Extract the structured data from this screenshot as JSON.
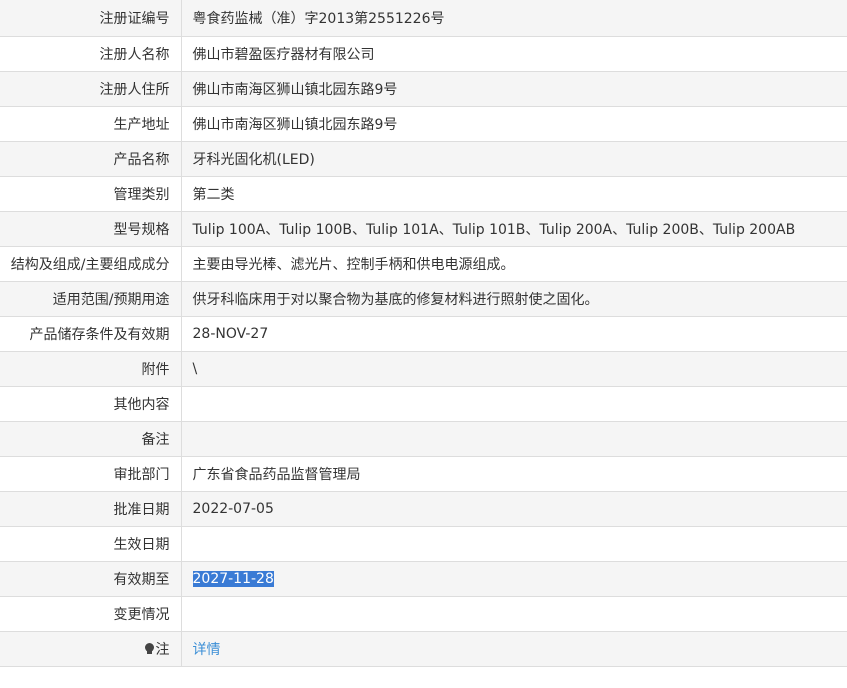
{
  "rows": [
    {
      "label": "注册证编号",
      "value": "粤食药监械（准）字2013第2551226号"
    },
    {
      "label": "注册人名称",
      "value": "佛山市碧盈医疗器材有限公司"
    },
    {
      "label": "注册人住所",
      "value": "佛山市南海区狮山镇北园东路9号"
    },
    {
      "label": "生产地址",
      "value": "佛山市南海区狮山镇北园东路9号"
    },
    {
      "label": "产品名称",
      "value": "牙科光固化机(LED)"
    },
    {
      "label": "管理类别",
      "value": "第二类"
    },
    {
      "label": "型号规格",
      "value": "Tulip 100A、Tulip 100B、Tulip 101A、Tulip 101B、Tulip 200A、Tulip 200B、Tulip 200AB"
    },
    {
      "label": "结构及组成/主要组成成分",
      "value": "主要由导光棒、滤光片、控制手柄和供电电源组成。"
    },
    {
      "label": "适用范围/预期用途",
      "value": "供牙科临床用于对以聚合物为基底的修复材料进行照射使之固化。"
    },
    {
      "label": "产品储存条件及有效期",
      "value": "28-NOV-27"
    },
    {
      "label": "附件",
      "value": "\\"
    },
    {
      "label": "其他内容",
      "value": ""
    },
    {
      "label": "备注",
      "value": ""
    },
    {
      "label": "审批部门",
      "value": "广东省食品药品监督管理局"
    },
    {
      "label": "批准日期",
      "value": "2022-07-05"
    },
    {
      "label": "生效日期",
      "value": ""
    },
    {
      "label": "有效期至",
      "value": "2027-11-28"
    },
    {
      "label": "变更情况",
      "value": ""
    }
  ],
  "note": {
    "icon": "lightbulb-icon",
    "label": "注",
    "link_text": "详情"
  },
  "colors": {
    "row_alt": "#f5f5f5",
    "border": "#dddddd",
    "selection": "#3a7bd5",
    "link": "#3c8fd6"
  }
}
